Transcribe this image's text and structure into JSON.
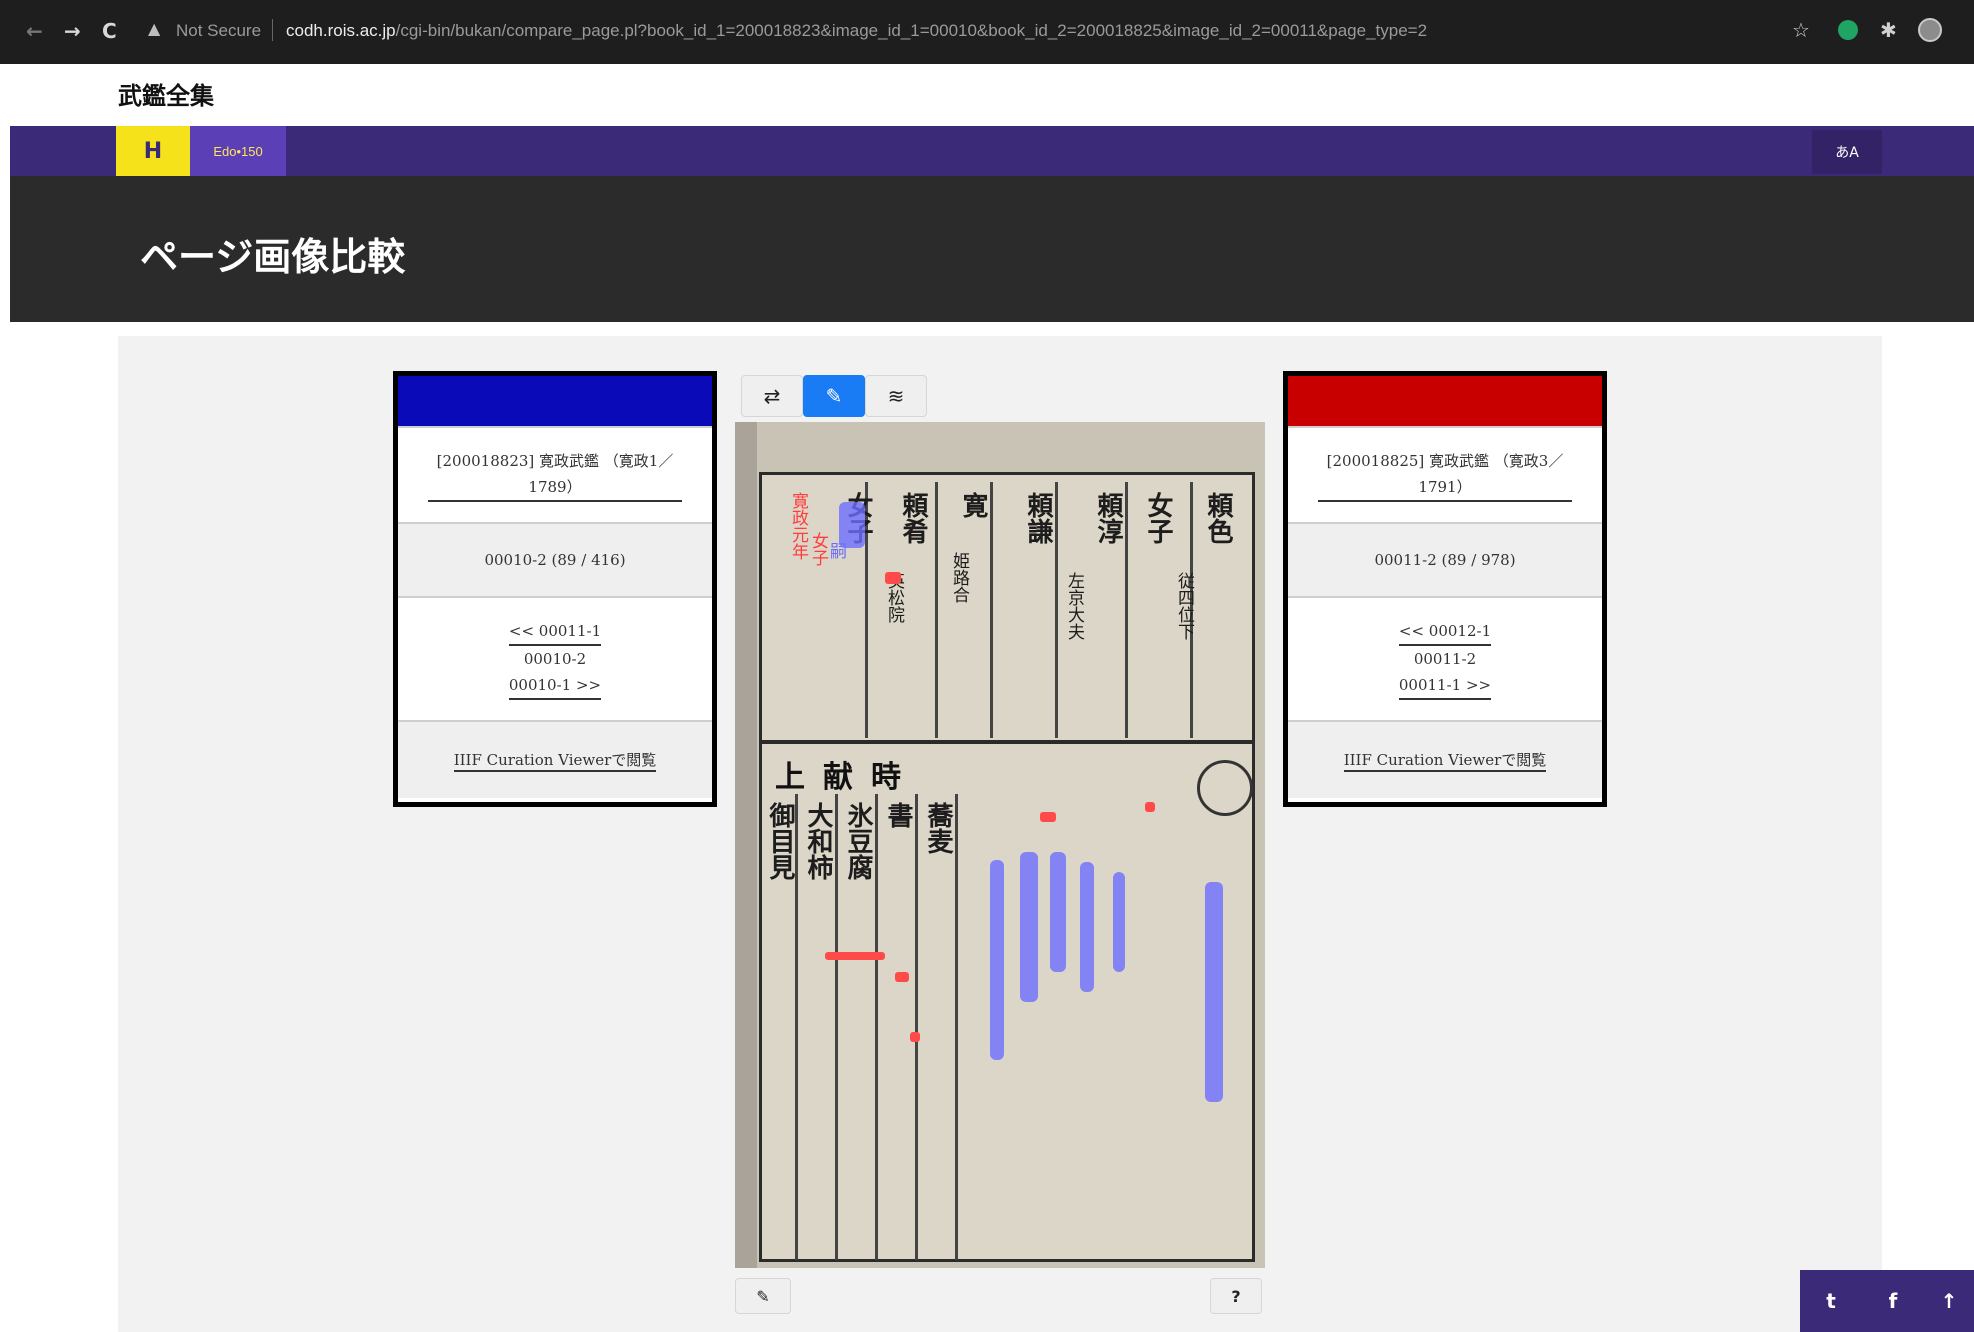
{
  "browser": {
    "not_secure": "Not Secure",
    "url_host": "codh.rois.ac.jp",
    "url_path": "/cgi-bin/bukan/compare_page.pl?book_id_1=200018823&image_id_1=00010&book_id_2=200018825&image_id_2=00011&page_type=2"
  },
  "site": {
    "title": "武鑑全集",
    "logo_text": "Edo•150",
    "page_heading": "ページ画像比較"
  },
  "colors": {
    "left_card": "#0a0ab8",
    "right_card": "#c80000",
    "navbar": "#3a2a78",
    "accent": "#1a7cf5"
  },
  "left_card": {
    "book_title": "[200018823] 寛政武鑑 （寛政1／1789）",
    "page_info": "00010-2 (89 / 416)",
    "prev": "<< 00011-1",
    "current": "00010-2",
    "next": "00010-1 >>",
    "viewer_link": "IIIF Curation Viewerで閲覧"
  },
  "right_card": {
    "book_title": "[200018825] 寛政武鑑 （寛政3／1791）",
    "page_info": "00011-2 (89 / 978)",
    "prev": "<< 00012-1",
    "current": "00011-2",
    "next": "00011-1 >>",
    "viewer_link": "IIIF Curation Viewerで閲覧"
  },
  "toolbar": {
    "swap_icon": "swap-icon",
    "edit_icon": "pen-icon",
    "layers_icon": "layers-icon"
  },
  "scan_text": {
    "upper": [
      "頼色",
      "女子",
      "頼淳",
      "頼謙",
      "寛",
      "頼肴",
      "女子"
    ],
    "lower_header": "上献時",
    "lower": [
      "大和柿",
      "氷豆腐",
      "書",
      "蕎麦",
      "御目見"
    ]
  },
  "bottom_tools": {
    "note_icon": "note-icon",
    "help": "?"
  },
  "share": {
    "twitter": "twitter-icon",
    "facebook": "facebook-icon",
    "top": "back-to-top-icon"
  }
}
